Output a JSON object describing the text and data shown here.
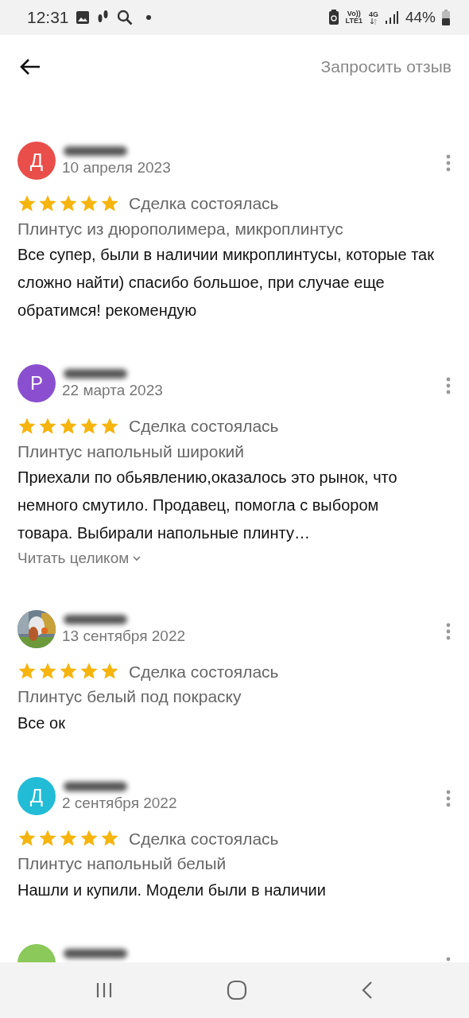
{
  "status_bar": {
    "time": "12:31",
    "volte": "Vo))",
    "lte": "LTE1",
    "network": "4G",
    "battery": "44%"
  },
  "header": {
    "action": "Запросить отзыв"
  },
  "reviews": [
    {
      "avatar": {
        "kind": "letter",
        "letter": "Д",
        "color": "#e94e4a"
      },
      "date": "10 апреля 2023",
      "stars": 5,
      "status": "Сделка состоялась",
      "product": "Плинтус из дюрополимера, микроплинтус",
      "text": "Все супер, были в наличии микроплинтусы, которые так сложно найти) спасибо большое, при случае еще обратимся! рекомендую"
    },
    {
      "avatar": {
        "kind": "letter",
        "letter": "Р",
        "color": "#8a4fcf"
      },
      "date": "22 марта 2023",
      "stars": 5,
      "status": "Сделка состоялась",
      "product": "Плинтус напольный широкий",
      "text": "Приехали по обьявлению,оказалось это рынок, что немного смутило. Продавец, помогла с выбором товара. Выбирали напольные плинту…",
      "read_more": "Читать целиком"
    },
    {
      "date": "13 сентября 2022",
      "stars": 5,
      "status": "Сделка состоялась",
      "product": "Плинтус белый под покраску",
      "text": "Все ок"
    },
    {
      "avatar": {
        "kind": "letter",
        "letter": "Д",
        "color": "#22bcd6"
      },
      "date": "2 сентября 2022",
      "stars": 5,
      "status": "Сделка состоялась",
      "product": "Плинтус напольный белый",
      "text": "Нашли и купили. Модели были в наличии"
    },
    {
      "avatar": {
        "kind": "blank",
        "color": "#8bc95a"
      }
    }
  ]
}
